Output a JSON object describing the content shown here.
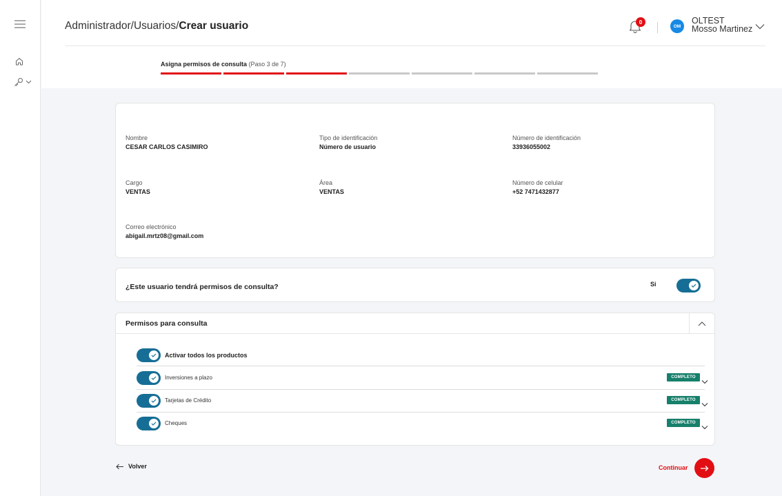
{
  "icons": {
    "menu": "menu-icon",
    "home": "home-icon",
    "keys": "key-icon",
    "bell": "bell-icon",
    "notification_count": "0"
  },
  "breadcrumb": {
    "segment1": "Administrador/",
    "segment2": "Usuarios/",
    "current": "Crear usuario"
  },
  "user": {
    "initials": "OM",
    "org": "OLTEST",
    "name": "Mosso Martinez"
  },
  "stepper": {
    "title": "Asigna permisos de consulta",
    "subtitle": "(Paso 3 de 7)",
    "completed": 3,
    "total": 7
  },
  "info": {
    "nombre_label": "Nombre",
    "nombre_value": "CESAR CARLOS CASIMIRO",
    "tipo_label": "Tipo de identificación",
    "tipo_value": "Número de usuario",
    "numero_label": "Número de identificación",
    "numero_value": "33936055002",
    "cargo_label": "Cargo",
    "cargo_value": "VENTAS",
    "area_label": "Área",
    "area_value": "VENTAS",
    "celular_label": "Número de celular",
    "celular_value": "+52 7471432877",
    "correo_label": "Correo electrónico",
    "correo_value": "abigail.mrtz08@gmail.com"
  },
  "consulta": {
    "question": "¿Este usuario tendrá permisos de consulta?",
    "answer": "Si",
    "enabled": true
  },
  "permisos": {
    "title": "Permisos para consulta",
    "all_label": "Activar todos los productos",
    "items": [
      {
        "label": "Inversiones a plazo",
        "status": "COMPLETO"
      },
      {
        "label": "Tarjetas de Crédito",
        "status": "COMPLETO"
      },
      {
        "label": "Cheques",
        "status": "COMPLETO"
      }
    ]
  },
  "footer": {
    "back_label": "Volver",
    "continue_label": "Continuar"
  },
  "colors": {
    "accent_red": "#e10f14",
    "toggle_blue": "#166e96",
    "badge_green": "#17806b",
    "avatar_blue": "#1789e4"
  }
}
